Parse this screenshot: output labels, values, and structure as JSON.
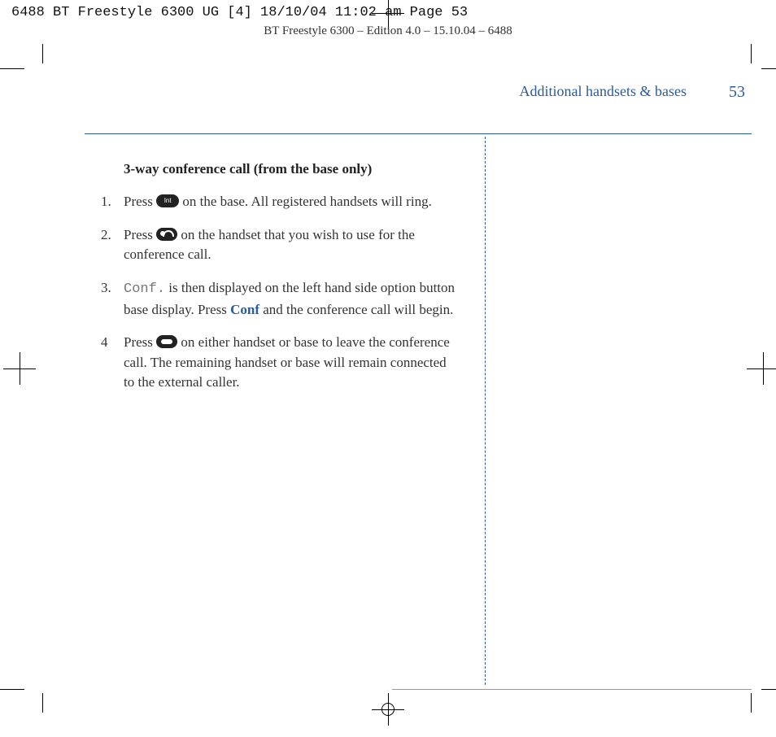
{
  "crop_info": "6488 BT Freestyle 6300 UG [4]  18/10/04  11:02 am  Page 53",
  "edition_line": "BT Freestyle 6300 – Edition 4.0 – 15.10.04 – 6488",
  "header": {
    "section": "Additional handsets & bases",
    "page": "53"
  },
  "content": {
    "heading": "3-way conference call (from the base only)",
    "steps": [
      {
        "num": "1.",
        "before": "Press ",
        "icon": "int-button-icon",
        "after": " on the base. All registered handsets will ring."
      },
      {
        "num": "2.",
        "before": "Press ",
        "icon": "int-handset-icon",
        "after": " on the handset that you wish to use for the conference call."
      },
      {
        "num": "3.",
        "mono": "Conf.",
        "mid1": " is then displayed on the left hand side option button base display. Press ",
        "bold": "Conf",
        "mid2": " and the conference call will begin."
      },
      {
        "num": "4",
        "before": "Press ",
        "icon": "end-call-icon",
        "after": " on either handset or base to leave the conference call. The remaining handset or base will remain connected to the external caller."
      }
    ]
  }
}
